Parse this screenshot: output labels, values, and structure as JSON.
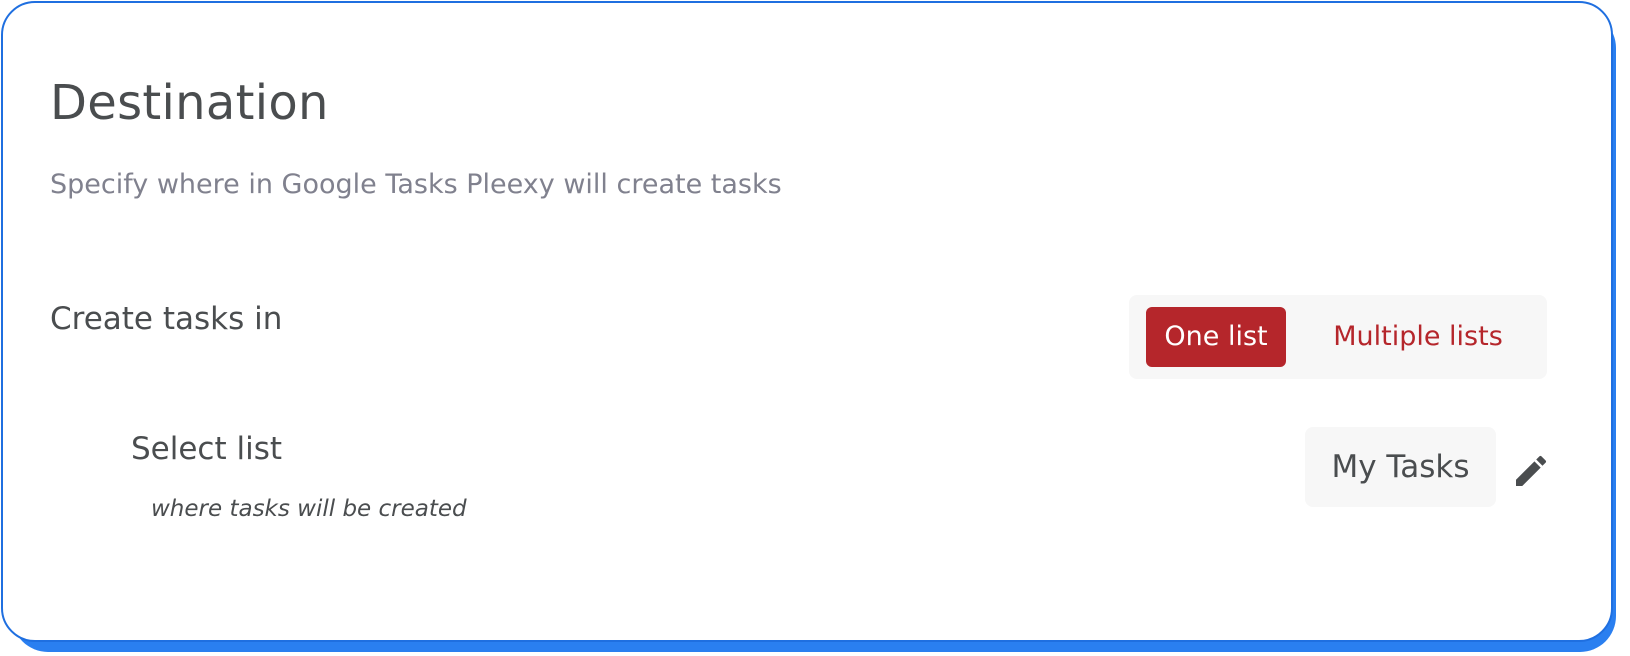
{
  "section": {
    "title": "Destination",
    "subtitle": "Specify where in Google Tasks Pleexy will create tasks"
  },
  "create_tasks": {
    "label": "Create tasks in",
    "options": [
      {
        "label": "One list",
        "selected": true
      },
      {
        "label": "Multiple lists",
        "selected": false
      }
    ]
  },
  "select_list": {
    "label": "Select list",
    "hint": "where tasks will be created",
    "value": "My Tasks",
    "edit_icon": "pencil-icon"
  },
  "colors": {
    "accent": "#b5262b",
    "card_border": "#1f6fe0",
    "card_shadow": "#2a7ff0",
    "text": "#4a4d4f",
    "muted_text": "#80818e",
    "control_bg": "#f7f7f7"
  }
}
